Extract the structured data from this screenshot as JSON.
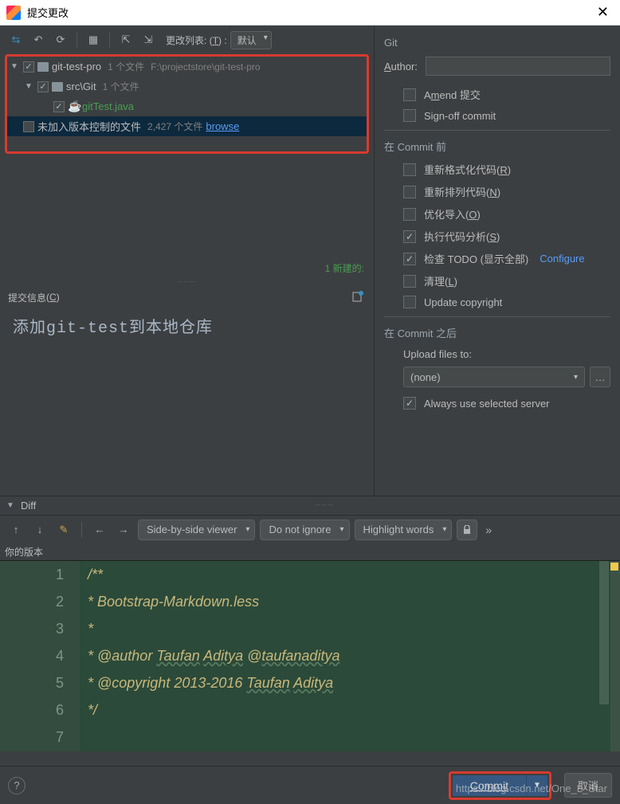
{
  "window": {
    "title": "提交更改"
  },
  "toolbar": {
    "changelist_label": "更改列表:",
    "changelist_key": "T",
    "changelist_value": "默认"
  },
  "tree": {
    "root": {
      "name": "git-test-pro",
      "count": "1 个文件",
      "path": "F:\\projectstore\\git-test-pro"
    },
    "child": {
      "name": "src\\Git",
      "count": "1 个文件"
    },
    "file": {
      "name": "gitTest.java"
    },
    "unversioned": {
      "label": "未加入版本控制的文件",
      "count": "2,427 个文件",
      "browse": "browse"
    }
  },
  "status": {
    "new_count": "1 新建的:"
  },
  "commit_msg": {
    "header": "提交信息",
    "header_key": "C",
    "text": "添加git-test到本地仓库"
  },
  "git": {
    "title": "Git",
    "author_label": "Author:",
    "author_key": "A",
    "amend": "Amend 提交",
    "amend_key": "m",
    "signoff": "Sign-off commit"
  },
  "before": {
    "title": "在 Commit 前",
    "reformat": "重新格式化代码",
    "reformat_key": "R",
    "rearrange": "重新排列代码",
    "rearrange_key": "N",
    "optimize": "优化导入",
    "optimize_key": "O",
    "analyze": "执行代码分析",
    "analyze_key": "S",
    "todo": "检查 TODO",
    "todo_paren": "(显示全部)",
    "configure": "Configure",
    "cleanup": "清理",
    "cleanup_key": "L",
    "copyright": "Update copyright"
  },
  "after": {
    "title": "在 Commit 之后",
    "upload_label": "Upload files to:",
    "upload_value": "(none)",
    "always": "Always use selected server"
  },
  "diff": {
    "title": "Diff",
    "viewer": "Side-by-side viewer",
    "ignore": "Do not ignore",
    "highlight": "Highlight words",
    "your_version": "你的版本"
  },
  "code": {
    "lines": [
      "1",
      "2",
      "3",
      "4",
      "5",
      "6",
      "7"
    ],
    "l1": "/**",
    "l2": " * Bootstrap-Markdown.less",
    "l3": " *",
    "l4a": " * @author ",
    "l4b": "Taufan",
    "l4c": " ",
    "l4d": "Aditya",
    "l4e": " @",
    "l4f": "taufanaditya",
    "l5a": " * @copyright 2013-2016 ",
    "l5b": "Taufan",
    "l5c": " ",
    "l5d": "Aditya",
    "l6": " */"
  },
  "footer": {
    "commit": "Commit",
    "cancel": "取消"
  },
  "watermark": "https://blog.csdn.net/One_L_Star"
}
